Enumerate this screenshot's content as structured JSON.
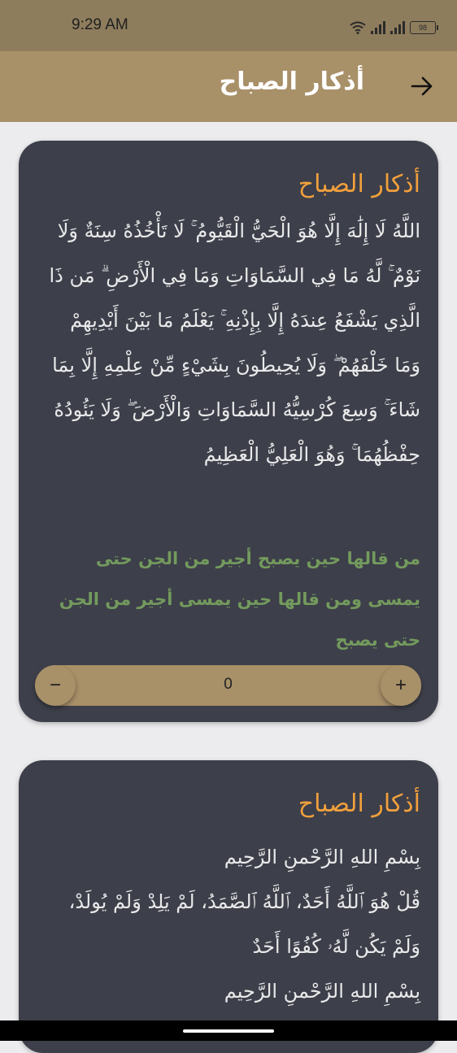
{
  "status_bar": {
    "time": "9:29 AM",
    "battery": "98"
  },
  "app_bar": {
    "title": "أذكار الصباح"
  },
  "cards": [
    {
      "title": "أذكار الصباح",
      "text": "اللَّهُ لَا إِلَٰهَ إِلَّا هُوَ الْحَيُّ الْقَيُّومُ ۚ لَا تَأْخُذُهُ سِنَةٌ وَلَا نَوْمٌ ۚ لَّهُ مَا فِي السَّمَاوَاتِ وَمَا فِي الْأَرْضِ ۗ مَن ذَا الَّذِي يَشْفَعُ عِندَهُ إِلَّا بِإِذْنِهِ ۚ يَعْلَمُ مَا بَيْنَ أَيْدِيهِمْ وَمَا خَلْفَهُمْ ۖ وَلَا يُحِيطُونَ بِشَيْءٍ مِّنْ عِلْمِهِ إِلَّا بِمَا شَاءَ ۚ وَسِعَ كُرْسِيُّهُ السَّمَاوَاتِ وَالْأَرْضَ ۖ وَلَا يَئُودُهُ حِفْظُهُمَا ۚ وَهُوَ الْعَلِيُّ الْعَظِيمُ",
      "virtue": "من قالها حين يصبح أجير من الجن حتى يمسى ومن قالها حين يمسى أجير من الجن حتى يصبح",
      "counter": "0",
      "minus": "−",
      "plus": "+"
    },
    {
      "title": "أذكار الصباح",
      "text": "بِسْمِ اللهِ الرَّحْمنِ الرَّحِيم\nقُلْ هُوَ ٱللَّهُ أَحَدٌ، ٱللَّهُ ٱلصَّمَدُ، لَمْ يَلِدْ وَلَمْ يُولَدْ، وَلَمْ يَكُن لَّهُۥ كُفُوًا أَحَدٌ\nبِسْمِ اللهِ الرَّحْمنِ الرَّحِيم"
    }
  ],
  "colors": {
    "status_bar": "#8e7d5d",
    "app_bar": "#a89068",
    "card_bg": "#3d3f4a",
    "card_title": "#f0a03c",
    "virtue": "#739a5d",
    "page_bg": "#ececee"
  },
  "icons": {
    "back": "arrow-right-icon",
    "wifi": "wifi-icon",
    "signal": "signal-icon",
    "battery": "battery-icon"
  }
}
